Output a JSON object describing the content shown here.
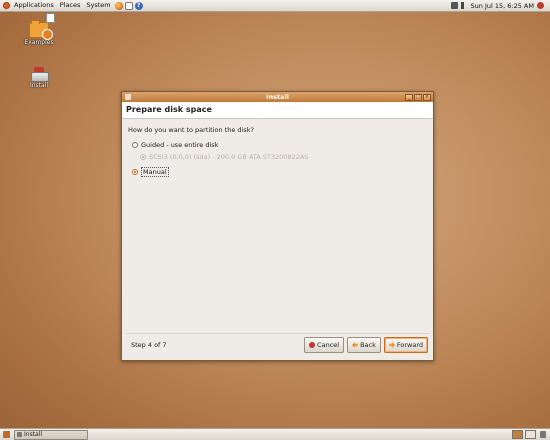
{
  "top_panel": {
    "menus": [
      "Applications",
      "Places",
      "System"
    ],
    "clock": "Sun Jul 15,  6:25 AM"
  },
  "desktop": {
    "icons": [
      {
        "label": "Examples",
        "icon": "folder-icon"
      },
      {
        "label": "Install",
        "icon": "installer-icon"
      }
    ]
  },
  "window": {
    "title": "Install",
    "header": "Prepare disk space",
    "question": "How do you want to partition the disk?",
    "options": [
      {
        "label": "Guided - use entire disk",
        "selected": false
      },
      {
        "label": "SCSI3 (0,0,0) (sda) - 200.0 GB ATA ST3200822AS",
        "selected": true,
        "disabled": true
      },
      {
        "label": "Manual",
        "selected": true
      }
    ],
    "step": "Step 4 of 7",
    "buttons": {
      "cancel": "Cancel",
      "back": "Back",
      "forward": "Forward"
    }
  },
  "bottom_panel": {
    "task": "Install"
  }
}
